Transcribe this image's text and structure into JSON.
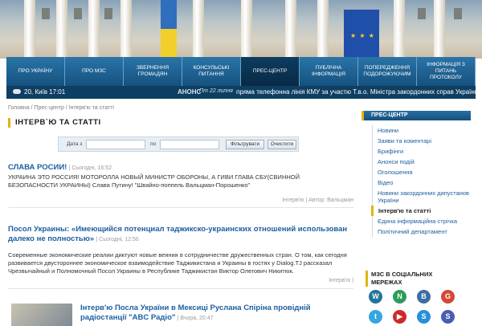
{
  "nav": [
    {
      "label": "Про Україну"
    },
    {
      "label": "Про МЗС"
    },
    {
      "label": "Звернення громадян"
    },
    {
      "label": "Консульські питання"
    },
    {
      "label": "Прес-центр"
    },
    {
      "label": "Публічна інформація"
    },
    {
      "label": "Попередження подорожуючим"
    },
    {
      "label": "Інформація з питань протоколу"
    }
  ],
  "strip": {
    "weather": "20, Київ 17:01",
    "anons_label": "АНОНС",
    "anons_date": "Пт 22 липня",
    "anons_text": "пряма телефонна лінія КМУ за участю Т.в.о. Міністра закордонних справ України"
  },
  "breadcrumb": "Головна / Прес-центр / Інтерв'ю та статті",
  "section_title": "ІНТЕРВ`Ю ТА СТАТТІ",
  "filter": {
    "from_label": "Дата з",
    "to_label": "по",
    "filter_button": "Фільтрувати",
    "clear_button": "Очистити"
  },
  "articles": [
    {
      "title": "СЛАВА РОСИИ!",
      "meta": "| Сьогодні, 16:52",
      "body": "УКРАИНА ЭТО РОССИЯ! МОТОРОЛЛА НОВЫЙ МИНИСТР ОБОРОНЫ, А ГИВИ ГЛАВА СБУ(СВИННОЙ БЕЗОПАСНОСТИ УКРАИНЫ) Слава Путину! \"Швайно-поппель Вальцман-Порошенко\"",
      "foot": "Інтерв'ю | Автор: Вальцман"
    },
    {
      "title": "Посол Украины: «Имеющийся потенциал таджикско-украинских отношений использован далеко не полностью»",
      "meta": "| Сьогодні, 12:56",
      "body": "Современные экономические реалии диктуют новые веяния в сотрудничестве дружественных стран. О том, как сегодня развивается двустороннее экономическое взаимодействие Таджикистана и Украины в гостях у Dialog.TJ рассказал Чрезвычайный и Полномочный Посол Украины в Республике Таджикистан Виктор Олегович Никитюк.",
      "foot": "Інтерв'ю |"
    },
    {
      "title": "Інтерв'ю Посла України в Мексиці Руслана Спіріна провідній радіостанції \"ABC Радіо\"",
      "meta": "| Вчора, 20:47"
    }
  ],
  "sidebar": {
    "header": "Прес-центр",
    "items": [
      "Новини",
      "Заяви та коментарі",
      "Брифінги",
      "Анонси подій",
      "Оголошення",
      "Відео",
      "Новини закордонних дипустанов України",
      "Інтерв'ю та статті",
      "Єдина інформаційна стрічка",
      "Політичний департамент"
    ],
    "active_index": 7,
    "social_title": "МЗС в соціальних мережах",
    "social": [
      {
        "icon": "wordpress-icon",
        "glyph": "W",
        "color": "#21759b"
      },
      {
        "icon": "livejournal-icon",
        "glyph": "N",
        "color": "#2a9d5b"
      },
      {
        "icon": "blogger-icon",
        "glyph": "B",
        "color": "#3b6ea5"
      },
      {
        "icon": "google-plus-icon",
        "glyph": "G",
        "color": "#d34836"
      },
      {
        "icon": "twitter-icon",
        "glyph": "t",
        "color": "#35a7e0"
      },
      {
        "icon": "youtube-icon",
        "glyph": "▶",
        "color": "#cc2a2a"
      },
      {
        "icon": "skype-icon",
        "glyph": "S",
        "color": "#2a8fd8"
      },
      {
        "icon": "pinterest-icon",
        "glyph": "S",
        "color": "#4a5db1"
      }
    ]
  }
}
